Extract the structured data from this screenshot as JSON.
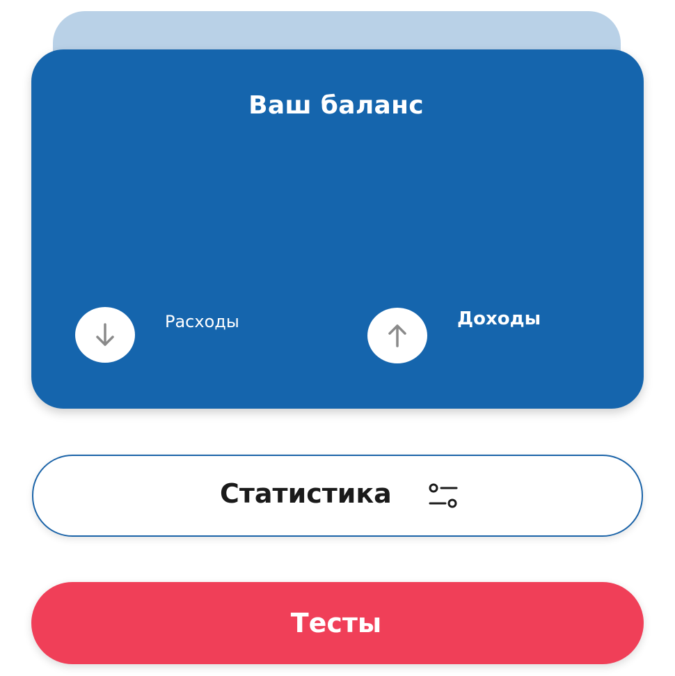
{
  "balance_card": {
    "title": "Ваш баланс",
    "expense_label": "Расходы",
    "income_label": "Доходы",
    "expense_icon": "arrow-down-icon",
    "income_icon": "arrow-up-icon"
  },
  "stats_button": {
    "label": "Статистика",
    "icon": "sliders-icon"
  },
  "tests_button": {
    "label": "Тесты"
  },
  "colors": {
    "card_blue": "#1565ad",
    "back_card": "#b9d1e7",
    "tests_red": "#f03f58",
    "icon_gray": "#8a8a8a"
  }
}
